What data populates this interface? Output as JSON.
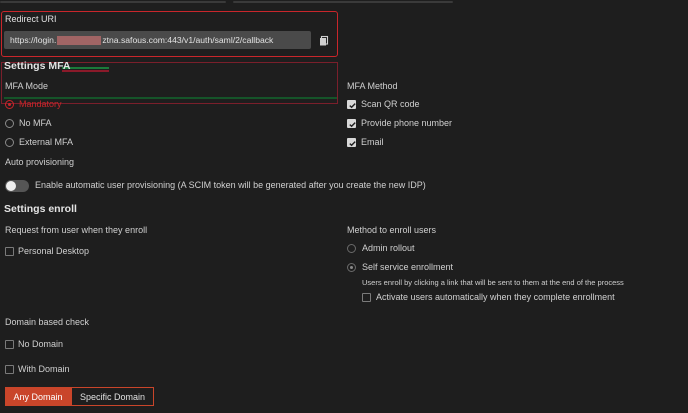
{
  "redirect": {
    "label": "Redirect URI",
    "uri_prefix": "https://login.",
    "uri_suffix": "ztna.safous.com:443/v1/auth/saml/2/callback",
    "copy_icon": "copy-icon"
  },
  "mfa": {
    "title": "Settings MFA",
    "mode_label": "MFA Mode",
    "modes": [
      "Mandatory",
      "No MFA",
      "External MFA"
    ],
    "method_label": "MFA Method",
    "methods": [
      "Scan QR code",
      "Provide phone number",
      "Email"
    ]
  },
  "provision": {
    "label": "Auto provisioning",
    "toggle_label": "Enable automatic user provisioning (A SCIM token will be generated after you create the new IDP)"
  },
  "enroll": {
    "title": "Settings enroll",
    "request_label": "Request from user when they enroll",
    "request_option": "Personal Desktop",
    "method_label": "Method to enroll users",
    "methods": [
      "Admin rollout",
      "Self service enrollment"
    ],
    "self_service_note": "Users enroll by clicking a link that will be sent to them at the end of the process",
    "activate_label": "Activate users automatically when they complete enrollment"
  },
  "domain": {
    "label": "Domain based check",
    "options": [
      "No Domain",
      "With Domain"
    ],
    "buttons": [
      "Any Domain",
      "Specific Domain"
    ]
  },
  "colors": {
    "accent": "#c9262b",
    "button": "#c9452a",
    "background": "#1e1e1e"
  }
}
